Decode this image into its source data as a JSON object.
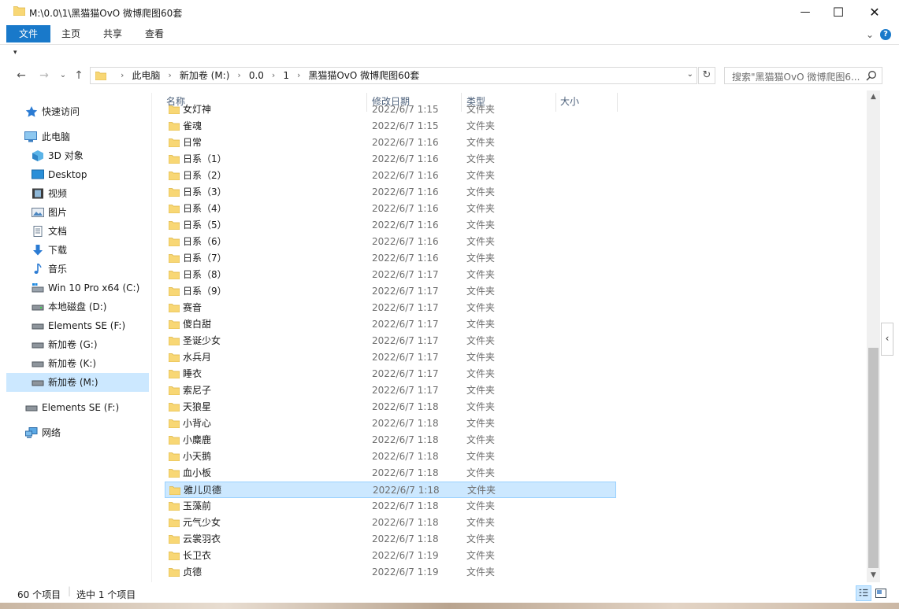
{
  "window": {
    "title": "M:\\0.0\\1\\黑猫猫OvO  微博爬图60套",
    "minimize": "—",
    "maximize": "☐",
    "close": "✕"
  },
  "ribbon": {
    "tabs": [
      {
        "label": "文件",
        "active": true
      },
      {
        "label": "主页"
      },
      {
        "label": "共享"
      },
      {
        "label": "查看"
      }
    ],
    "expand": "⌄",
    "help": "?"
  },
  "quick_access_toolbar": {
    "dropdown": "▾"
  },
  "navigation": {
    "back": "←",
    "forward": "→",
    "recent": "⌄",
    "up": "↑"
  },
  "address_bar": {
    "crumbs": [
      "此电脑",
      "新加卷 (M:)",
      "0.0",
      "1",
      "黑猫猫OvO  微博爬图60套"
    ],
    "separator": "›",
    "dropdown": "⌄",
    "refresh": "↻"
  },
  "search": {
    "placeholder": "搜索\"黑猫猫OvO  微博爬图6..."
  },
  "nav_pane": [
    {
      "label": "快速访问",
      "icon": "star-icon"
    },
    {
      "label": "此电脑",
      "icon": "computer-icon"
    },
    {
      "label": "3D 对象",
      "icon": "cube-icon"
    },
    {
      "label": "Desktop",
      "icon": "desktop-icon"
    },
    {
      "label": "视频",
      "icon": "video-icon"
    },
    {
      "label": "图片",
      "icon": "picture-icon"
    },
    {
      "label": "文档",
      "icon": "document-icon"
    },
    {
      "label": "下载",
      "icon": "download-icon"
    },
    {
      "label": "音乐",
      "icon": "music-icon"
    },
    {
      "label": "Win 10 Pro x64 (C:)",
      "icon": "system-drive-icon"
    },
    {
      "label": "本地磁盘 (D:)",
      "icon": "drive-icon"
    },
    {
      "label": "Elements SE (F:)",
      "icon": "drive-icon"
    },
    {
      "label": "新加卷 (G:)",
      "icon": "drive-icon"
    },
    {
      "label": "新加卷 (K:)",
      "icon": "drive-icon"
    },
    {
      "label": "新加卷 (M:)",
      "icon": "drive-icon",
      "selected": true
    },
    {
      "label": "Elements SE (F:)",
      "icon": "drive-icon"
    },
    {
      "label": "网络",
      "icon": "network-icon"
    }
  ],
  "columns": {
    "name": "名称",
    "modified": "修改日期",
    "type": "类型",
    "size": "大小",
    "sort_indicator": "^"
  },
  "files": [
    {
      "name": "女灯神",
      "modified": "2022/6/7 1:15",
      "type": "文件夹"
    },
    {
      "name": "雀魂",
      "modified": "2022/6/7 1:15",
      "type": "文件夹"
    },
    {
      "name": "日常",
      "modified": "2022/6/7 1:16",
      "type": "文件夹"
    },
    {
      "name": "日系（1）",
      "modified": "2022/6/7 1:16",
      "type": "文件夹"
    },
    {
      "name": "日系（2）",
      "modified": "2022/6/7 1:16",
      "type": "文件夹"
    },
    {
      "name": "日系（3）",
      "modified": "2022/6/7 1:16",
      "type": "文件夹"
    },
    {
      "name": "日系（4）",
      "modified": "2022/6/7 1:16",
      "type": "文件夹"
    },
    {
      "name": "日系（5）",
      "modified": "2022/6/7 1:16",
      "type": "文件夹"
    },
    {
      "name": "日系（6）",
      "modified": "2022/6/7 1:16",
      "type": "文件夹"
    },
    {
      "name": "日系（7）",
      "modified": "2022/6/7 1:16",
      "type": "文件夹"
    },
    {
      "name": "日系（8）",
      "modified": "2022/6/7 1:17",
      "type": "文件夹"
    },
    {
      "name": "日系（9）",
      "modified": "2022/6/7 1:17",
      "type": "文件夹"
    },
    {
      "name": "赛音",
      "modified": "2022/6/7 1:17",
      "type": "文件夹"
    },
    {
      "name": "傻白甜",
      "modified": "2022/6/7 1:17",
      "type": "文件夹"
    },
    {
      "name": "圣诞少女",
      "modified": "2022/6/7 1:17",
      "type": "文件夹"
    },
    {
      "name": "水兵月",
      "modified": "2022/6/7 1:17",
      "type": "文件夹"
    },
    {
      "name": "睡衣",
      "modified": "2022/6/7 1:17",
      "type": "文件夹"
    },
    {
      "name": "索尼子",
      "modified": "2022/6/7 1:17",
      "type": "文件夹"
    },
    {
      "name": "天狼星",
      "modified": "2022/6/7 1:18",
      "type": "文件夹"
    },
    {
      "name": "小背心",
      "modified": "2022/6/7 1:18",
      "type": "文件夹"
    },
    {
      "name": "小麋鹿",
      "modified": "2022/6/7 1:18",
      "type": "文件夹"
    },
    {
      "name": "小天鹅",
      "modified": "2022/6/7 1:18",
      "type": "文件夹"
    },
    {
      "name": "血小板",
      "modified": "2022/6/7 1:18",
      "type": "文件夹"
    },
    {
      "name": "雅儿贝德",
      "modified": "2022/6/7 1:18",
      "type": "文件夹",
      "selected": true
    },
    {
      "name": "玉藻前",
      "modified": "2022/6/7 1:18",
      "type": "文件夹"
    },
    {
      "name": "元气少女",
      "modified": "2022/6/7 1:18",
      "type": "文件夹"
    },
    {
      "name": "云裳羽衣",
      "modified": "2022/6/7 1:18",
      "type": "文件夹"
    },
    {
      "name": "长卫衣",
      "modified": "2022/6/7 1:19",
      "type": "文件夹"
    },
    {
      "name": "贞德",
      "modified": "2022/6/7 1:19",
      "type": "文件夹"
    }
  ],
  "scrollbar": {
    "up": "▲",
    "down": "▼"
  },
  "side_panel_toggle": "‹",
  "status": {
    "count": "60 个项目",
    "selection": "选中 1 个项目"
  },
  "colors": {
    "accent": "#1979ca",
    "selection": "#cce8ff",
    "folder": "#f8d775"
  }
}
